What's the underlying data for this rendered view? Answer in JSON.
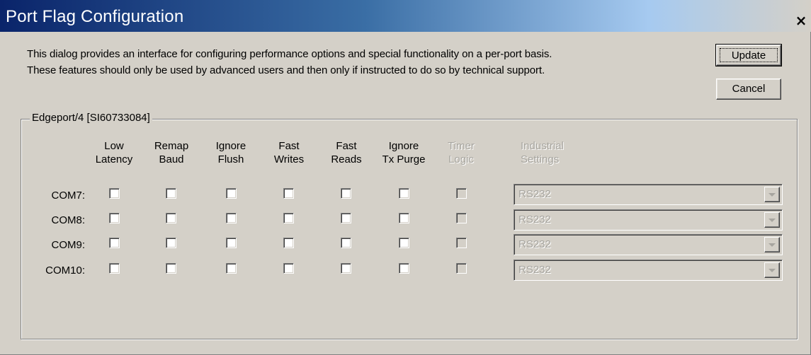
{
  "window": {
    "title": "Port Flag Configuration",
    "close_symbol": "×"
  },
  "description": {
    "line1": "This dialog provides an interface for configuring performance options and special functionality on a per-port basis.",
    "line2": "These features should only be used by advanced users and then only if instructed to do so by technical support."
  },
  "buttons": {
    "update": "Update",
    "cancel": "Cancel"
  },
  "group": {
    "label": "Edgeport/4 [SI60733084]"
  },
  "columns": [
    {
      "line1": "Low",
      "line2": "Latency",
      "enabled": true
    },
    {
      "line1": "Remap",
      "line2": "Baud",
      "enabled": true
    },
    {
      "line1": "Ignore",
      "line2": "Flush",
      "enabled": true
    },
    {
      "line1": "Fast",
      "line2": "Writes",
      "enabled": true
    },
    {
      "line1": "Fast",
      "line2": "Reads",
      "enabled": true
    },
    {
      "line1": "Ignore",
      "line2": "Tx Purge",
      "enabled": true
    },
    {
      "line1": "Timer",
      "line2": "Logic",
      "enabled": false
    },
    {
      "line1": "Industrial",
      "line2": "Settings",
      "enabled": false
    }
  ],
  "rows": [
    {
      "port": "COM7:",
      "flags": [
        false,
        false,
        false,
        false,
        false,
        false,
        false
      ],
      "industrial_setting": "RS232"
    },
    {
      "port": "COM8:",
      "flags": [
        false,
        false,
        false,
        false,
        false,
        false,
        false
      ],
      "industrial_setting": "RS232"
    },
    {
      "port": "COM9:",
      "flags": [
        false,
        false,
        false,
        false,
        false,
        false,
        false
      ],
      "industrial_setting": "RS232"
    },
    {
      "port": "COM10:",
      "flags": [
        false,
        false,
        false,
        false,
        false,
        false,
        false
      ],
      "industrial_setting": "RS232"
    }
  ],
  "colors": {
    "title_gradient_start": "#0a246a",
    "dialog_face": "#d4d0c8",
    "disabled_text": "#a7a59f"
  }
}
